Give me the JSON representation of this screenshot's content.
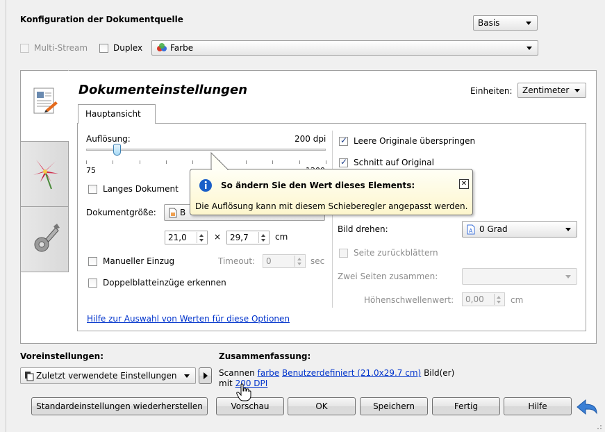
{
  "source_config": {
    "title": "Konfiguration der Dokumentquelle",
    "mode_select": "Basis",
    "multi_stream_label": "Multi-Stream",
    "duplex_label": "Duplex",
    "color_select": "Farbe"
  },
  "doc_settings": {
    "title": "Dokumenteinstellungen",
    "units_label": "Einheiten:",
    "units_value": "Zentimeter",
    "tab_label": "Hauptansicht"
  },
  "resolution": {
    "label": "Auflösung:",
    "value_text": "200 dpi",
    "min_label": "75",
    "max_label": "1200",
    "min": 75,
    "max": 1200,
    "value": 200
  },
  "left_options": {
    "long_document_label": "Langes Dokument",
    "doc_size_label": "Dokumentgröße:",
    "doc_size_value": "B",
    "width_value": "21,0",
    "times": "×",
    "height_value": "29,7",
    "unit": "cm",
    "manual_feed_label": "Manueller Einzug",
    "timeout_label": "Timeout:",
    "timeout_value": "0",
    "timeout_unit": "sec",
    "double_feed_label": "Doppelblatteinzüge erkennen"
  },
  "right_options": {
    "skip_blank_label": "Leere Originale überspringen",
    "crop_label": "Schnitt auf Original",
    "rotate_label": "Bild drehen:",
    "rotate_value": "0 Grad",
    "page_back_label": "Seite zurückblättern",
    "merge_label": "Zwei Seiten zusammen:",
    "merge_value": "",
    "height_threshold_label": "Höhenschwellenwert:",
    "height_threshold_value": "0,00",
    "height_threshold_unit": "cm"
  },
  "help_link": "Hilfe zur Auswahl von Werten für diese Optionen",
  "tooltip": {
    "title": "So ändern Sie den Wert dieses Elements:",
    "body": "Die Auflösung kann mit diesem Schieberegler angepasst werden.",
    "close": "✕"
  },
  "presets": {
    "label": "Voreinstellungen:",
    "value": "Zuletzt verwendete Einstellungen"
  },
  "summary": {
    "label": "Zusammenfassung:",
    "line1_prefix": "Scannen",
    "color_link": "farbe",
    "size_link": "Benutzerdefiniert (21.0x29.7 cm)",
    "line1_suffix": "Bild(er)",
    "line2_prefix": "mit",
    "dpi_link": "200 DPI"
  },
  "buttons": {
    "reset": "Standardeinstellungen wiederherstellen",
    "preview": "Vorschau",
    "ok": "OK",
    "save": "Speichern",
    "done": "Fertig",
    "help": "Hilfe"
  },
  "colors": {
    "link": "#0033cc",
    "tooltip_bg": "#fdf6cc",
    "info_icon": "#1a5fc8",
    "back_arrow": "#3a7fd5"
  }
}
